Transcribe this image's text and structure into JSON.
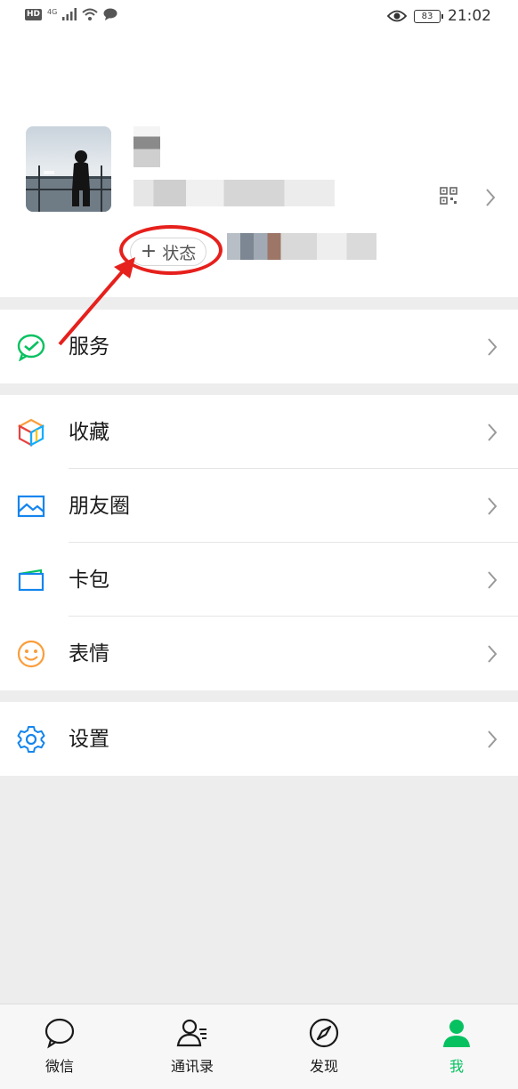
{
  "status_bar": {
    "hd": "HD",
    "network": "4G",
    "battery": "83",
    "time": "21:02"
  },
  "profile": {
    "status_button_label": "状态",
    "status_button_plus": "+"
  },
  "menu": {
    "services": {
      "label": "服务",
      "icon": "wechat-pay-icon"
    },
    "favorites": {
      "label": "收藏",
      "icon": "cube-icon"
    },
    "moments": {
      "label": "朋友圈",
      "icon": "picture-icon"
    },
    "cards": {
      "label": "卡包",
      "icon": "card-wallet-icon"
    },
    "stickers": {
      "label": "表情",
      "icon": "smile-icon"
    },
    "settings": {
      "label": "设置",
      "icon": "gear-icon"
    }
  },
  "tabbar": {
    "chats": "微信",
    "contacts": "通讯录",
    "discover": "发现",
    "me": "我"
  },
  "colors": {
    "accent_green": "#07c160",
    "annotation_red": "#e6201c",
    "background_gray": "#ededed"
  }
}
